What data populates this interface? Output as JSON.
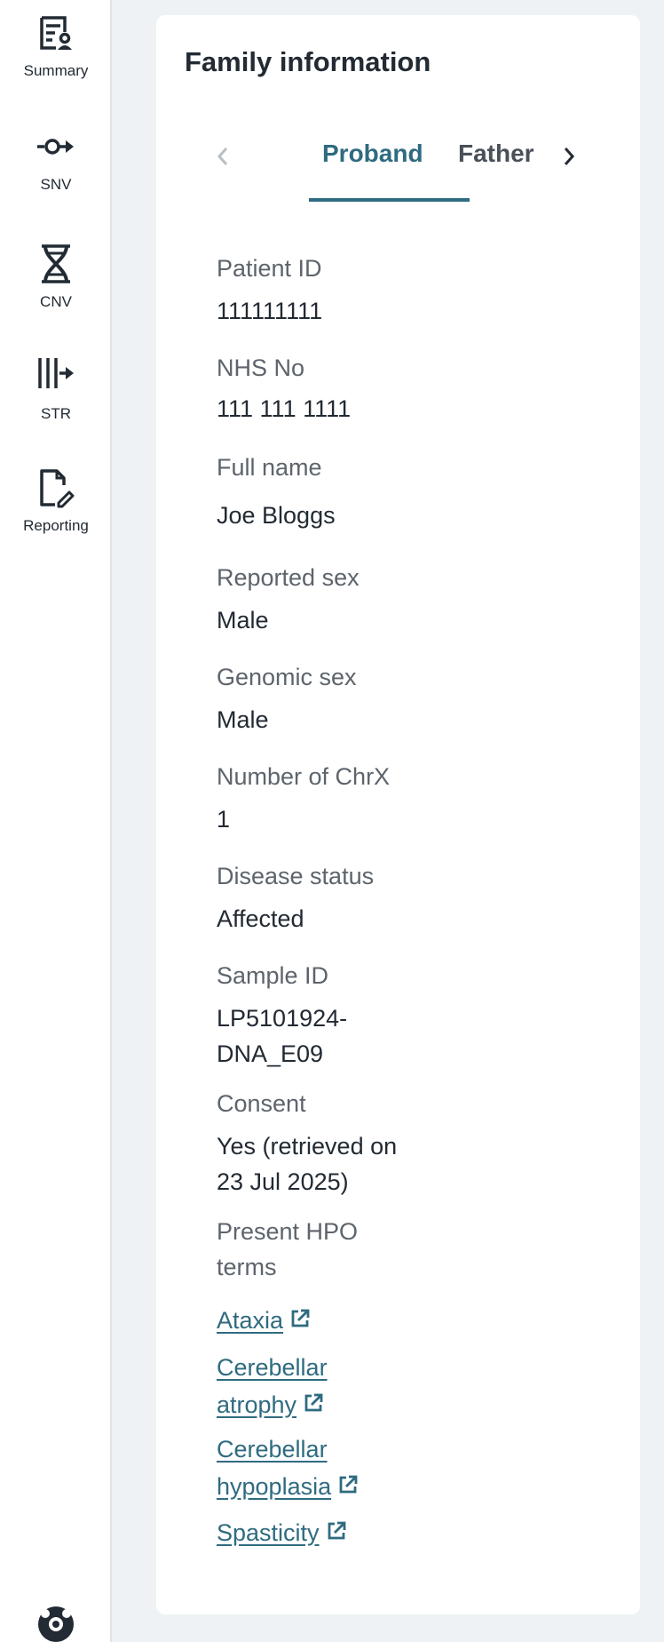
{
  "sidebar": {
    "items": [
      {
        "label": "Summary",
        "icon": "summary-icon"
      },
      {
        "label": "SNV",
        "icon": "snv-icon"
      },
      {
        "label": "CNV",
        "icon": "dna-icon"
      },
      {
        "label": "STR",
        "icon": "str-icon"
      },
      {
        "label": "Reporting",
        "icon": "report-edit-icon"
      }
    ],
    "help_icon": "help-lifebuoy-icon"
  },
  "card": {
    "title": "Family information",
    "tabs": [
      {
        "label": "Proband",
        "active": true
      },
      {
        "label": "Father",
        "active": false
      }
    ],
    "fields": [
      {
        "label": "Patient ID",
        "value": "111111111"
      },
      {
        "label": "NHS No",
        "value": "111 111 1111"
      },
      {
        "label": "Full name",
        "value": "Joe Bloggs"
      },
      {
        "label": "Reported sex",
        "value": "Male"
      },
      {
        "label": "Genomic sex",
        "value": "Male"
      },
      {
        "label": "Number of ChrX",
        "value": "1"
      },
      {
        "label": "Disease status",
        "value": "Affected"
      },
      {
        "label": "Sample ID",
        "value_lines": [
          "LP5101924-",
          "DNA_E09"
        ]
      },
      {
        "label": "Consent",
        "value_lines": [
          "Yes (retrieved on",
          "23 Jul 2025)"
        ]
      }
    ],
    "hpo": {
      "label_lines": [
        "Present HPO",
        "terms"
      ],
      "terms": [
        {
          "lines": [
            "Ataxia"
          ]
        },
        {
          "lines": [
            "Cerebellar",
            "atrophy"
          ]
        },
        {
          "lines": [
            "Cerebellar",
            "hypoplasia"
          ]
        },
        {
          "lines": [
            "Spasticity"
          ]
        }
      ]
    }
  },
  "colors": {
    "accent": "#2f6b80",
    "background": "#eef2f4",
    "text": "#222a33",
    "muted": "#5d646c"
  }
}
